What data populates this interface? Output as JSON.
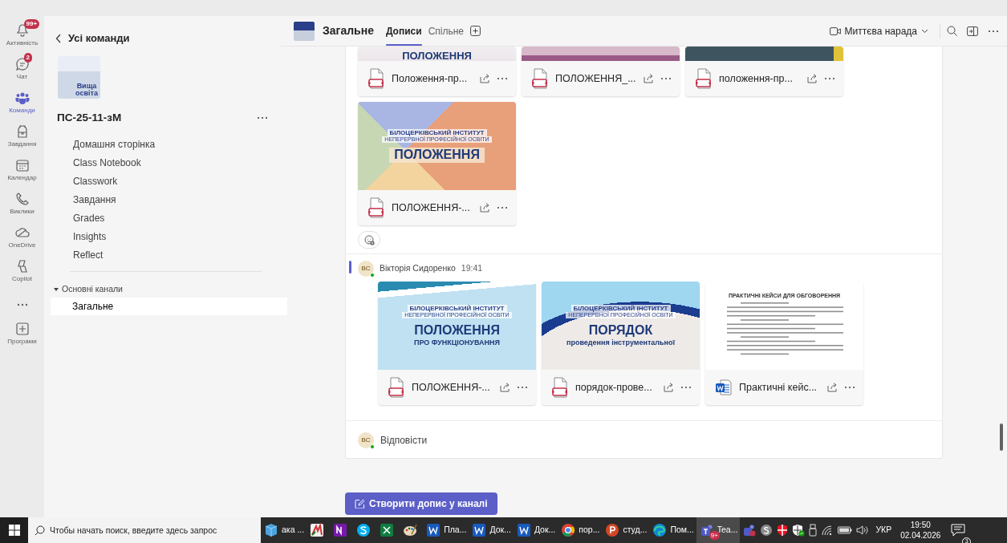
{
  "nav_rail": [
    {
      "label": "Активність",
      "badge": "99+",
      "selected": false
    },
    {
      "label": "Чат",
      "badge": "2",
      "selected": false
    },
    {
      "label": "Команди",
      "selected": true
    },
    {
      "label": "Завдання",
      "selected": false
    },
    {
      "label": "Календар",
      "selected": false
    },
    {
      "label": "Виклики",
      "selected": false
    },
    {
      "label": "OneDrive",
      "selected": false
    },
    {
      "label": "Copilot",
      "selected": false
    },
    {
      "selected": false
    },
    {
      "label": "Програми",
      "selected": false
    }
  ],
  "teams_panel": {
    "back_label": "Усі команди",
    "logo_text": "Вища освіта",
    "team_name": "ПС-25-11-зМ",
    "items": [
      "Домашня сторінка",
      "Class Notebook",
      "Classwork",
      "Завдання",
      "Grades",
      "Insights",
      "Reflect"
    ],
    "section": {
      "label": "Основні канали",
      "expanded": true,
      "channels": [
        {
          "label": "Загальне",
          "selected": true
        }
      ]
    }
  },
  "channel_header": {
    "title": "Загальне",
    "tabs": [
      {
        "label": "Дописи",
        "selected": true
      },
      {
        "label": "Спільне",
        "selected": false
      }
    ],
    "meet_button": "Миттєва нарада"
  },
  "posts": [
    {
      "file_rows": [
        [
          {
            "name": "Положення-пр...",
            "kind": "pdf",
            "preview": {
              "lines": [
                {
                  "text": "ПОЛОЖЕННЯ",
                  "kind": "title"
                }
              ]
            }
          },
          {
            "name": "ПОЛОЖЕННЯ_...",
            "kind": "pdf"
          },
          {
            "name": "положення-пр...",
            "kind": "pdf"
          }
        ],
        [
          {
            "name": "ПОЛОЖЕННЯ-...",
            "kind": "pdf",
            "preview": {
              "lines": [
                {
                  "text": "БІЛОЦЕРКІВСЬКИЙ ІНСТИТУТ",
                  "kind": "org"
                },
                {
                  "text": "НЕПЕРЕРВНОЇ ПРОФЕСІЙНОЇ ОСВІТИ",
                  "kind": "org-sub"
                },
                {
                  "text": "ПОЛОЖЕННЯ",
                  "kind": "title"
                }
              ]
            }
          }
        ]
      ],
      "reaction": true
    },
    {
      "author": "Вікторія Сидоренко",
      "time": "19:41",
      "initials": "ВС",
      "online": true,
      "file_rows": [
        [
          {
            "name": "ПОЛОЖЕННЯ-...",
            "kind": "pdf",
            "preview": {
              "lines": [
                {
                  "text": "БІЛОЦЕРКІВСЬКИЙ ІНСТИТУТ",
                  "kind": "org"
                },
                {
                  "text": "НЕПЕРЕРВНОЇ ПРОФЕСІЙНОЇ ОСВІТИ",
                  "kind": "org-sub"
                },
                {
                  "text": "ПОЛОЖЕННЯ",
                  "kind": "title"
                },
                {
                  "text": "ПРО ФУНКЦІОНУВАННЯ",
                  "kind": "subtitle"
                }
              ]
            }
          },
          {
            "name": "порядок-прове...",
            "kind": "pdf",
            "preview": {
              "lines": [
                {
                  "text": "БІЛОЦЕРКІВСЬКИЙ ІНСТИТУТ",
                  "kind": "org"
                },
                {
                  "text": "НЕПЕРЕРВНОЇ ПРОФЕСІЙНОЇ ОСВІТИ",
                  "kind": "org-sub"
                },
                {
                  "text": "ПОРЯДОК",
                  "kind": "title"
                },
                {
                  "text": "проведення інструментальної",
                  "kind": "subtitle"
                }
              ]
            }
          },
          {
            "name": "Практичні кейс...",
            "kind": "word",
            "preview": {
              "lines": [
                {
                  "text": "ПРАКТИЧНІ КЕЙСИ ДЛЯ ОБГОВОРЕННЯ",
                  "kind": "doc-title"
                }
              ]
            }
          }
        ]
      ],
      "reply": {
        "initials": "ВС",
        "label": "Відповісти"
      }
    }
  ],
  "new_post_button": "Створити допис у каналі",
  "taskbar": {
    "search_placeholder": "Чтобы начать поиск, введите здесь запрос",
    "apps": [
      {
        "label": "ака ...",
        "active": false
      },
      {
        "active": false
      },
      {
        "active": false
      },
      {
        "active": false
      },
      {
        "active": false
      },
      {
        "active": false
      },
      {
        "label": "Пла...",
        "active": false
      },
      {
        "label": "Док...",
        "active": false
      },
      {
        "label": "Док...",
        "active": false
      },
      {
        "label": "пор...",
        "active": false
      },
      {
        "label": "студ...",
        "active": false
      },
      {
        "label": "Пом...",
        "active": false
      },
      {
        "label": "Tea...",
        "badge": "9+",
        "active": true
      }
    ],
    "language": "УКР",
    "time": "19:50",
    "date": "02.04.2026",
    "notifications": "3"
  }
}
